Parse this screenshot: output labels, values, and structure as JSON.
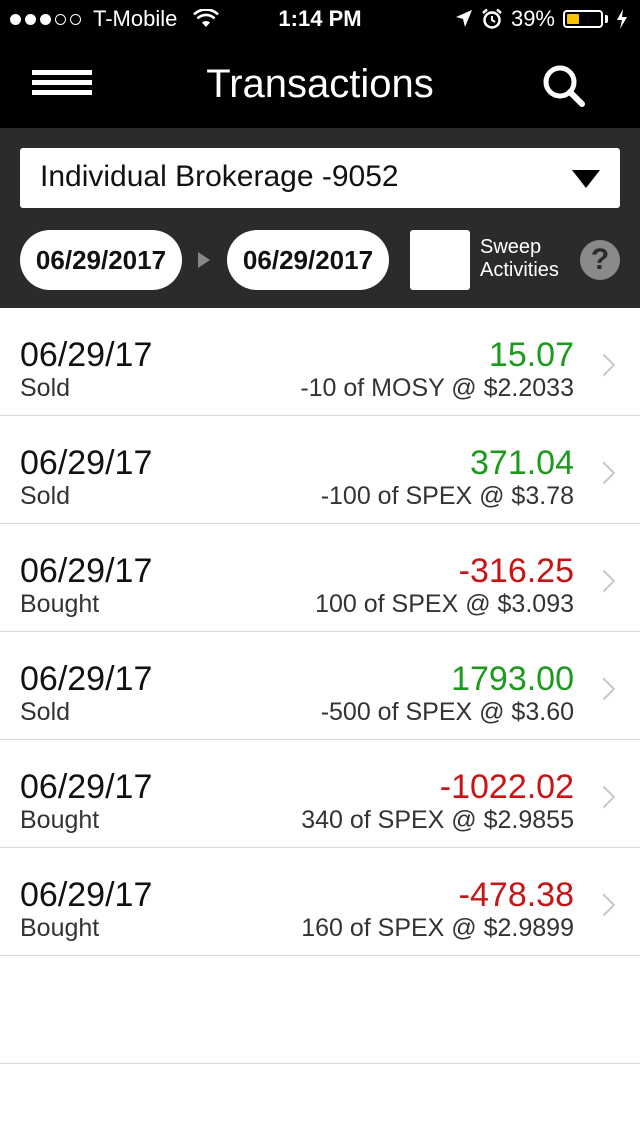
{
  "status_bar": {
    "carrier": "T-Mobile",
    "signal_full": 3,
    "signal_total": 5,
    "time": "1:14 PM",
    "battery_text": "39%",
    "battery_level": 0.39,
    "battery_color": "#f5c400"
  },
  "nav": {
    "title": "Transactions",
    "menu_icon": "hamburger-icon",
    "search_icon": "search-icon"
  },
  "filters": {
    "account": "Individual Brokerage -9052",
    "start_date": "06/29/2017",
    "end_date": "06/29/2017",
    "sweep_line1": "Sweep",
    "sweep_line2": "Activities",
    "help": "?"
  },
  "colors": {
    "positive": "#1d9a1d",
    "negative": "#c81414"
  },
  "transactions": [
    {
      "date": "06/29/17",
      "type": "Sold",
      "amount": "15.07",
      "detail": "-10 of MOSY @ $2.2033",
      "sign": "positive"
    },
    {
      "date": "06/29/17",
      "type": "Sold",
      "amount": "371.04",
      "detail": "-100 of SPEX @ $3.78",
      "sign": "positive"
    },
    {
      "date": "06/29/17",
      "type": "Bought",
      "amount": "-316.25",
      "detail": "100 of SPEX @ $3.093",
      "sign": "negative"
    },
    {
      "date": "06/29/17",
      "type": "Sold",
      "amount": "1793.00",
      "detail": "-500 of SPEX @ $3.60",
      "sign": "positive"
    },
    {
      "date": "06/29/17",
      "type": "Bought",
      "amount": "-1022.02",
      "detail": "340 of SPEX @ $2.9855",
      "sign": "negative"
    },
    {
      "date": "06/29/17",
      "type": "Bought",
      "amount": "-478.38",
      "detail": "160 of SPEX @ $2.9899",
      "sign": "negative"
    }
  ]
}
